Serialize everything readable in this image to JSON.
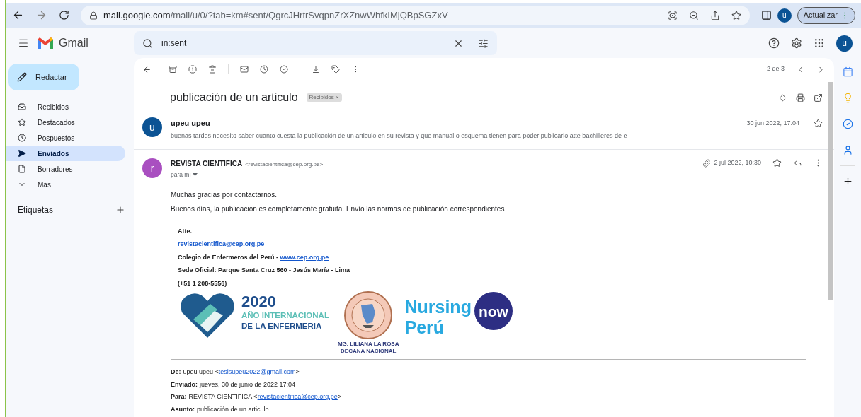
{
  "browser": {
    "url_host": "mail.google.com",
    "url_path": "/mail/u/0/?tab=km#sent/QgrcJHrtrSvqpnZrXZnwWhfkIMjQBpSGZxV",
    "profile_initial": "u",
    "update_button": "Actualizar"
  },
  "header": {
    "app_name": "Gmail",
    "search_value": "in:sent",
    "avatar_initial": "u"
  },
  "compose_button": "Redactar",
  "nav": [
    {
      "label": "Recibidos",
      "selected": false
    },
    {
      "label": "Destacados",
      "selected": false
    },
    {
      "label": "Pospuestos",
      "selected": false
    },
    {
      "label": "Enviados",
      "selected": true
    },
    {
      "label": "Borradores",
      "selected": false
    },
    {
      "label": "Más",
      "selected": false
    }
  ],
  "labels_heading": "Etiquetas",
  "toolbar": {
    "counter": "2 de 3"
  },
  "thread": {
    "subject": "publicación de un articulo",
    "label_chip": "Recibidos",
    "chip_close": "×"
  },
  "messages": [
    {
      "kind": "collapsed",
      "initial": "u",
      "color": "#0b5394",
      "sender": "upeu upeu",
      "snippet": "buenas tardes necesito saber cuanto cuesta la publicación de un articulo en su revista y que manual o esquema tienen para poder publicarlo atte bachilleres de e",
      "date": "30 jun 2022, 17:04"
    },
    {
      "kind": "expanded",
      "initial": "r",
      "color": "#a94fc0",
      "sender": "REVISTA CIENTIFICA",
      "address": "<revistacientifica@cep.org.pe>",
      "recipient": "para mí",
      "date": "2 jul 2022, 10:30",
      "has_attachment": true,
      "body": [
        "Muchas gracias por contactarnos.",
        "Buenos días, la publicación es completamente gratuita. Envío las normas de publicación correspondientes"
      ],
      "signature": [
        [
          {
            "text": "Atte.",
            "link": false
          }
        ],
        [
          {
            "text": "revistacientifica@cep.org.pe",
            "link": true
          }
        ],
        [
          {
            "text": "Colegio de Enfermeros del Perú - ",
            "link": false
          },
          {
            "text": "www.cep.org.pe",
            "link": true
          }
        ],
        [
          {
            "text": "Sede Oficial: Parque Santa Cruz 560 - Jesús María - Lima",
            "link": false
          }
        ],
        [
          {
            "text": "(+51 1 208-5556)",
            "link": false
          }
        ]
      ],
      "logos": {
        "year": "2020",
        "line1": "AÑO INTERNACIONAL",
        "line2": "DE LA ENFERMERIA",
        "dean_name": "MG. LILIANA LA ROSA",
        "dean_title": "DECANA NACIONAL",
        "nursing": "Nursing",
        "now": "now",
        "country": "Perú"
      },
      "quoted": [
        {
          "label": "De:",
          "parts": [
            {
              "text": "upeu upeu <",
              "link": false
            },
            {
              "text": "tesisupeu2022@gmail.com",
              "link": true
            },
            {
              "text": ">",
              "link": false
            }
          ]
        },
        {
          "label": "Enviado:",
          "parts": [
            {
              "text": "jueves, 30 de junio de 2022 17:04",
              "link": false
            }
          ]
        },
        {
          "label": "Para:",
          "parts": [
            {
              "text": "REVISTA CIENTIFICA <",
              "link": false
            },
            {
              "text": "revistacientifica@cep.org.pe",
              "link": true
            },
            {
              "text": ">",
              "link": false
            }
          ]
        },
        {
          "label": "Asunto:",
          "parts": [
            {
              "text": "publicación de un articulo",
              "link": false
            }
          ]
        }
      ]
    }
  ]
}
